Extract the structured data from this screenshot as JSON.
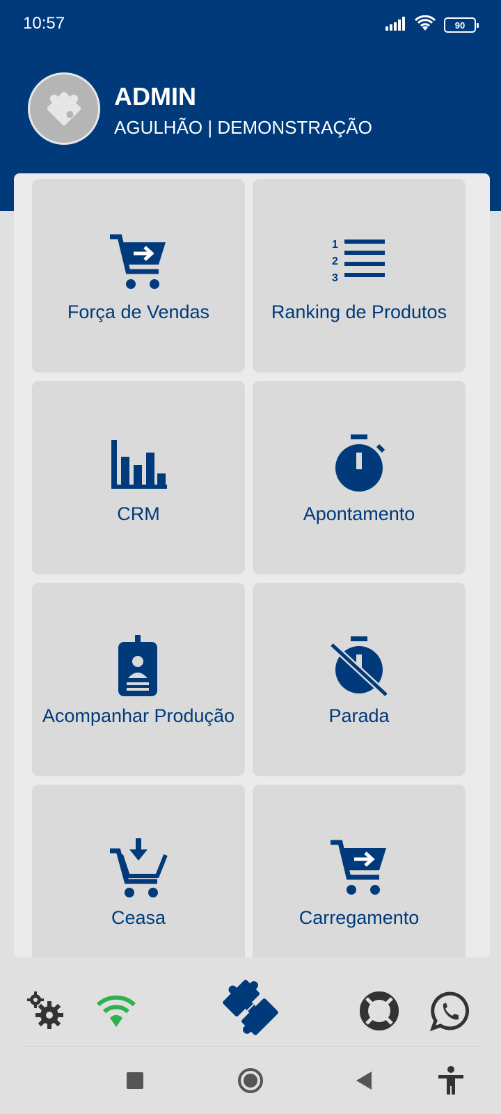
{
  "status_bar": {
    "time": "10:57",
    "battery": "90"
  },
  "user": {
    "name": "ADMIN",
    "company": "AGULHÃO | DEMONSTRAÇÃO"
  },
  "menu": {
    "items": [
      {
        "label": "Força de Vendas",
        "icon": "cart-arrow-icon"
      },
      {
        "label": "Ranking de Produtos",
        "icon": "ranked-list-icon"
      },
      {
        "label": "CRM",
        "icon": "bar-chart-icon"
      },
      {
        "label": "Apontamento",
        "icon": "stopwatch-icon"
      },
      {
        "label": "Acompanhar Produção",
        "icon": "badge-icon"
      },
      {
        "label": "Parada",
        "icon": "stopwatch-off-icon"
      },
      {
        "label": "Ceasa",
        "icon": "cart-download-icon"
      },
      {
        "label": "Carregamento",
        "icon": "cart-arrow-icon"
      }
    ]
  },
  "bottom_bar": {
    "items": [
      "settings-icon",
      "wifi-icon",
      "puzzle-logo-icon",
      "lifebuoy-icon",
      "whatsapp-icon"
    ]
  },
  "nav_bar": {
    "items": [
      "recents-button",
      "home-button",
      "back-button",
      "accessibility-button"
    ]
  },
  "colors": {
    "primary": "#003a7b",
    "background": "#e0e0e0",
    "tile": "#dadada",
    "wifi": "#2fb14b",
    "dark_icon": "#333333"
  }
}
